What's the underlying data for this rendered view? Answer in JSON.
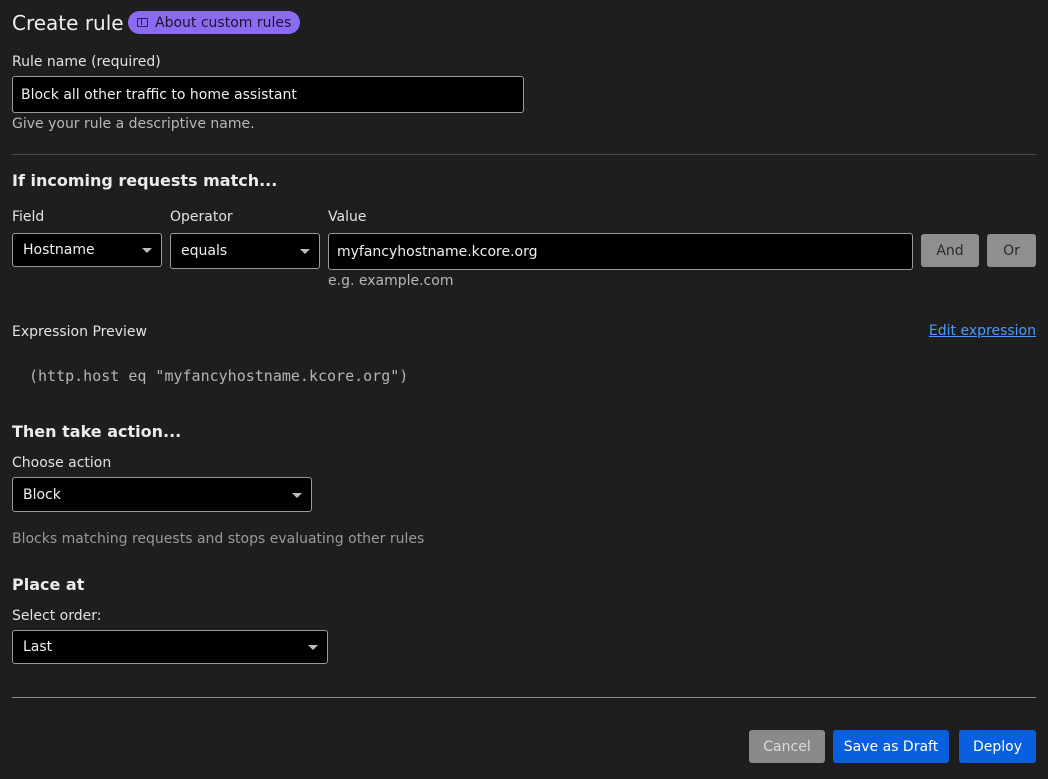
{
  "header": {
    "title": "Create rule",
    "about_label": "About custom rules",
    "about_icon": "book-icon"
  },
  "rule_name": {
    "label": "Rule name (required)",
    "value": "Block all other traffic to home assistant",
    "hint": "Give your rule a descriptive name."
  },
  "match": {
    "title": "If incoming requests match...",
    "field_label": "Field",
    "field_value": "Hostname",
    "operator_label": "Operator",
    "operator_value": "equals",
    "value_label": "Value",
    "value_value": "myfancyhostname.kcore.org",
    "value_hint": "e.g. example.com",
    "and_label": "And",
    "or_label": "Or"
  },
  "expression": {
    "label": "Expression Preview",
    "edit_link": "Edit expression",
    "code": "(http.host eq \"myfancyhostname.kcore.org\")"
  },
  "action": {
    "title": "Then take action...",
    "label": "Choose action",
    "value": "Block",
    "description": "Blocks matching requests and stops evaluating other rules"
  },
  "place": {
    "title": "Place at",
    "label": "Select order:",
    "value": "Last"
  },
  "footer": {
    "cancel_label": "Cancel",
    "draft_label": "Save as Draft",
    "deploy_label": "Deploy"
  },
  "colors": {
    "background": "#1e1e1e",
    "accent_blue": "#0a5fe0",
    "pill_purple": "#8b6cf0",
    "link_blue": "#4b9bff"
  }
}
